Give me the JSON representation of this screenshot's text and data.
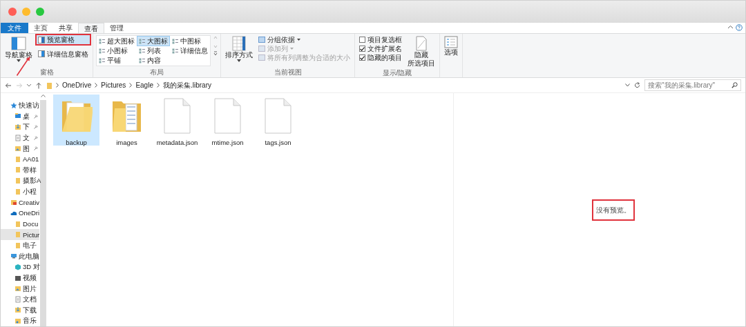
{
  "window": {
    "traffic_lights": [
      {
        "color": "#fe5f57"
      },
      {
        "color": "#febc2e"
      },
      {
        "color": "#28c840"
      }
    ]
  },
  "ribbon": {
    "tabs": [
      {
        "label": "文件",
        "kind": "file",
        "selected": false
      },
      {
        "label": "主页",
        "kind": "tab",
        "selected": false
      },
      {
        "label": "共享",
        "kind": "tab",
        "selected": false
      },
      {
        "label": "查看",
        "kind": "tab",
        "selected": true
      },
      {
        "label": "管理",
        "kind": "tab",
        "selected": false
      }
    ],
    "panes": {
      "label": "窗格",
      "navigation": "导航窗格",
      "preview": {
        "label": "预览窗格",
        "selected": true,
        "highlighted": true
      },
      "details": "详细信息窗格"
    },
    "layout": {
      "label": "布局",
      "options": [
        {
          "label": "超大图标",
          "selected": false
        },
        {
          "label": "大图标",
          "selected": true
        },
        {
          "label": "中图标",
          "selected": false
        },
        {
          "label": "小图标",
          "selected": false
        },
        {
          "label": "列表",
          "selected": false
        },
        {
          "label": "详细信息",
          "selected": false
        },
        {
          "label": "平铺",
          "selected": false
        },
        {
          "label": "内容",
          "selected": false
        }
      ]
    },
    "current_view": {
      "label": "当前视图",
      "sort": "排序方式",
      "commands": [
        {
          "label": "分组依据",
          "dropdown": true,
          "disabled": false
        },
        {
          "label": "添加列",
          "dropdown": true,
          "disabled": true
        },
        {
          "label": "将所有列调整为合适的大小",
          "dropdown": false,
          "disabled": true
        }
      ]
    },
    "show_hide": {
      "label": "显示/隐藏",
      "checkboxes": [
        {
          "label": "项目复选框",
          "checked": false
        },
        {
          "label": "文件扩展名",
          "checked": true
        },
        {
          "label": "隐藏的项目",
          "checked": true
        }
      ],
      "hide_selected": [
        "隐藏",
        "所选项目"
      ]
    },
    "options": "选项"
  },
  "address": {
    "breadcrumb": [
      "OneDrive",
      "Pictures",
      "Eagle",
      "我的采集.library"
    ],
    "search_placeholder": "搜索\"我的采集.library\""
  },
  "sidebar": [
    {
      "label": "快速访",
      "kind": "star",
      "selected": false,
      "children": [
        {
          "label": "桌",
          "kind": "desktop",
          "pinned": true,
          "selected": false
        },
        {
          "label": "下",
          "kind": "download",
          "pinned": true,
          "selected": false
        },
        {
          "label": "文",
          "kind": "document",
          "pinned": true,
          "selected": false
        },
        {
          "label": "图",
          "kind": "image",
          "pinned": true,
          "selected": false
        },
        {
          "label": "AA01",
          "kind": "folder",
          "pinned": false,
          "selected": false
        },
        {
          "label": "带样",
          "kind": "folder",
          "pinned": false,
          "selected": false
        },
        {
          "label": "摄影A",
          "kind": "folder",
          "pinned": false,
          "selected": false
        },
        {
          "label": "小程",
          "kind": "folder",
          "pinned": false,
          "selected": false
        }
      ]
    },
    {
      "label": "Creativ",
      "kind": "creative",
      "selected": false
    },
    {
      "label": "OneDri",
      "kind": "cloud",
      "selected": false,
      "children": [
        {
          "label": "Docu",
          "kind": "folder",
          "pinned": false,
          "selected": false
        },
        {
          "label": "Pictur",
          "kind": "folder",
          "pinned": false,
          "selected": true
        },
        {
          "label": "电子",
          "kind": "folder",
          "pinned": false,
          "selected": false
        }
      ]
    },
    {
      "label": "此电脑",
      "kind": "computer",
      "selected": false,
      "children": [
        {
          "label": "3D 对",
          "kind": "cube",
          "pinned": false,
          "selected": false
        },
        {
          "label": "视频",
          "kind": "video",
          "pinned": false,
          "selected": false
        },
        {
          "label": "图片",
          "kind": "image",
          "pinned": false,
          "selected": false
        },
        {
          "label": "文档",
          "kind": "document",
          "pinned": false,
          "selected": false
        },
        {
          "label": "下载",
          "kind": "download",
          "pinned": false,
          "selected": false
        },
        {
          "label": "音乐",
          "kind": "music",
          "pinned": false,
          "selected": false
        }
      ]
    }
  ],
  "files": [
    {
      "name": "backup",
      "kind": "folder",
      "selected": true
    },
    {
      "name": "images",
      "kind": "folder-full",
      "selected": false
    },
    {
      "name": "metadata.json",
      "kind": "file",
      "selected": false
    },
    {
      "name": "mtime.json",
      "kind": "file",
      "selected": false
    },
    {
      "name": "tags.json",
      "kind": "file",
      "selected": false
    }
  ],
  "preview": {
    "message": "没有预览。",
    "highlighted": true
  }
}
